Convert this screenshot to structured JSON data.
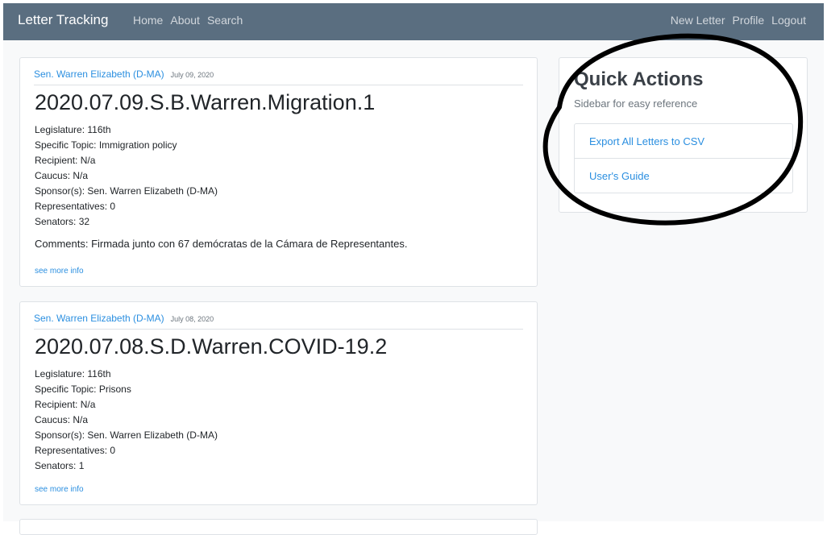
{
  "navbar": {
    "brand": "Letter Tracking",
    "left_links": [
      "Home",
      "About",
      "Search"
    ],
    "right_links": [
      "New Letter",
      "Profile",
      "Logout"
    ]
  },
  "letters": [
    {
      "sponsor_link": "Sen. Warren Elizabeth (D-MA)",
      "date": "July 09, 2020",
      "title": "2020.07.09.S.B.Warren.Migration.1",
      "fields": [
        "Legislature: 116th",
        "Specific Topic: Immigration policy",
        "Recipient: N/a",
        "Caucus: N/a",
        "Sponsor(s): Sen. Warren Elizabeth (D-MA)",
        "Representatives: 0",
        "Senators: 32"
      ],
      "comments": "Comments: Firmada junto con 67 demócratas de la Cámara de Representantes.",
      "see_more": "see more info"
    },
    {
      "sponsor_link": "Sen. Warren Elizabeth (D-MA)",
      "date": "July 08, 2020",
      "title": "2020.07.08.S.D.Warren.COVID-19.2",
      "fields": [
        "Legislature: 116th",
        "Specific Topic: Prisons",
        "Recipient: N/a",
        "Caucus: N/a",
        "Sponsor(s): Sen. Warren Elizabeth (D-MA)",
        "Representatives: 0",
        "Senators: 1"
      ],
      "see_more": "see more info"
    }
  ],
  "sidebar": {
    "title": "Quick Actions",
    "subtitle": "Sidebar for easy reference",
    "actions": [
      "Export All Letters to CSV",
      "User's Guide"
    ]
  },
  "colors": {
    "navbar": "#5a6e80",
    "link": "#2b8fe0",
    "page_background": "#f8f9fa",
    "annotation": "#000000"
  }
}
